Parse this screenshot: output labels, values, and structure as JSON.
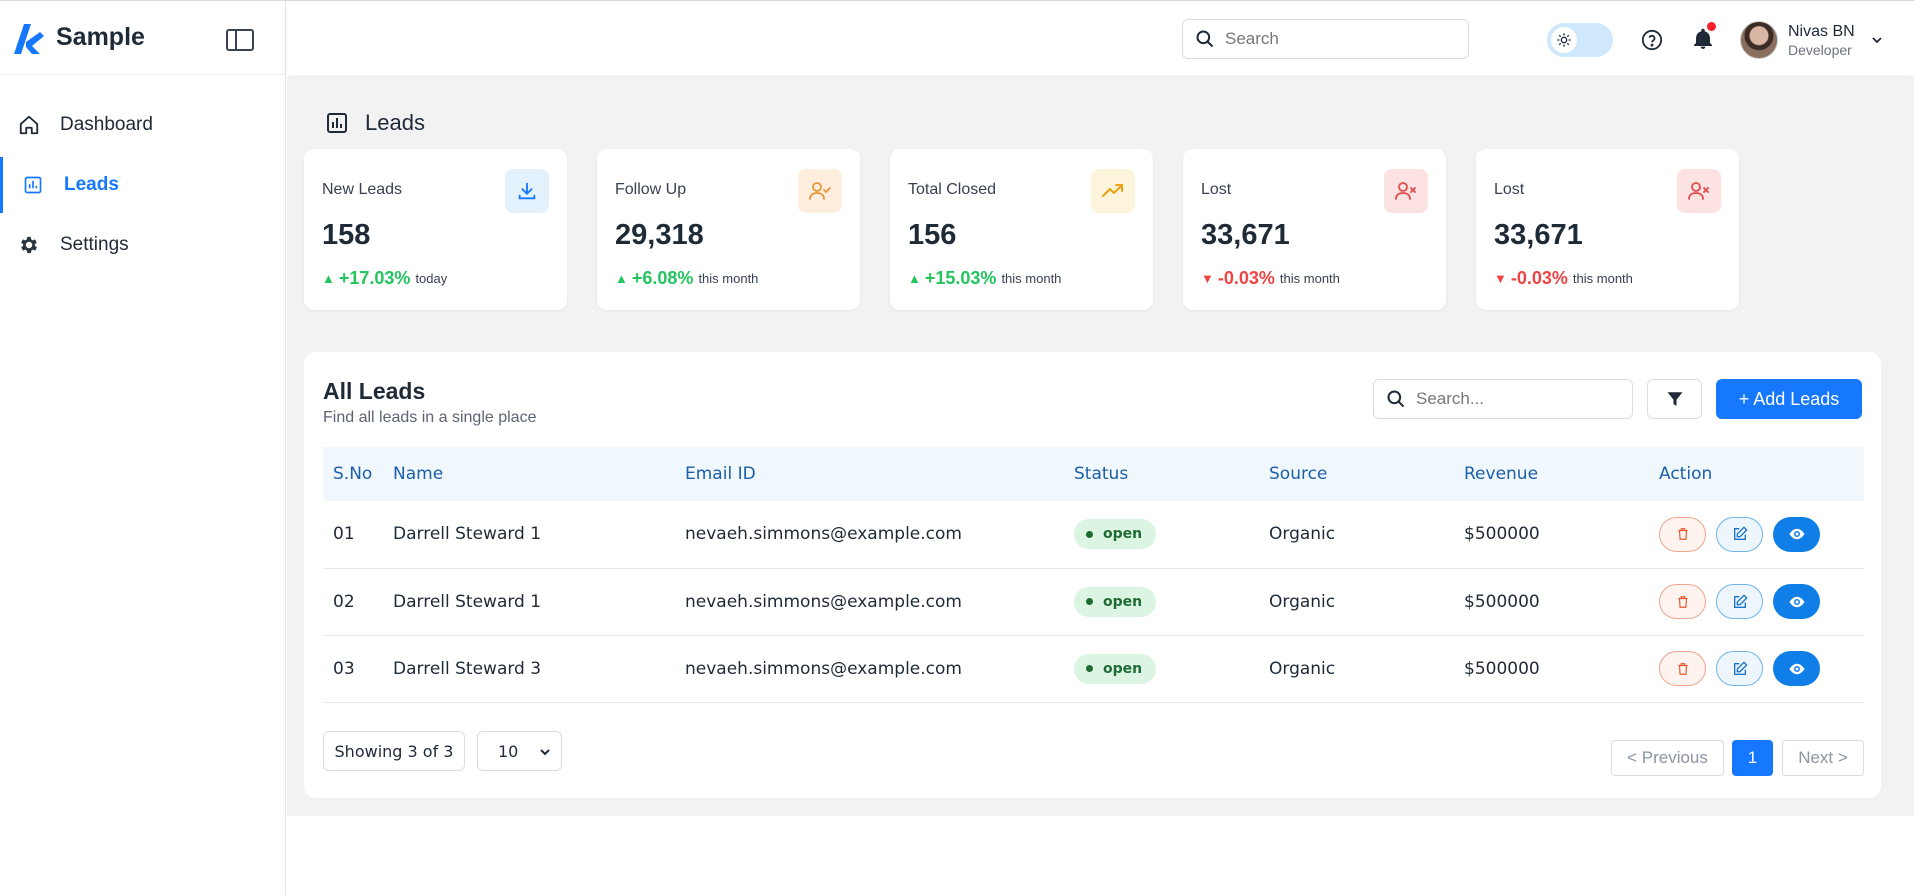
{
  "app": {
    "name": "Sample",
    "accent": "#1677ff"
  },
  "sidebar": {
    "items": [
      {
        "label": "Dashboard",
        "icon": "home-icon",
        "active": false
      },
      {
        "label": "Leads",
        "icon": "bar-chart-icon",
        "active": true
      },
      {
        "label": "Settings",
        "icon": "gear-icon",
        "active": false
      }
    ]
  },
  "topbar": {
    "search_placeholder": "Search",
    "user": {
      "name": "Nivas BN",
      "role": "Developer"
    }
  },
  "page": {
    "title": "Leads"
  },
  "stats": [
    {
      "label": "New Leads",
      "value": "158",
      "trend": "+17.03%",
      "direction": "up",
      "period": "today",
      "icon": "download-icon",
      "icon_bg": "#e3f1fd",
      "icon_color": "#1677ff"
    },
    {
      "label": "Follow Up",
      "value": "29,318",
      "trend": "+6.08%",
      "direction": "up",
      "period": "this month",
      "icon": "user-check-icon",
      "icon_bg": "#fdeedd",
      "icon_color": "#e8953b"
    },
    {
      "label": "Total Closed",
      "value": "156",
      "trend": "+15.03%",
      "direction": "up",
      "period": "this month",
      "icon": "trending-up-icon",
      "icon_bg": "#fdf4dc",
      "icon_color": "#e9a215"
    },
    {
      "label": "Lost",
      "value": "33,671",
      "trend": "-0.03%",
      "direction": "down",
      "period": "this month",
      "icon": "user-x-icon",
      "icon_bg": "#fde2e2",
      "icon_color": "#e24b4b"
    },
    {
      "label": "Lost",
      "value": "33,671",
      "trend": "-0.03%",
      "direction": "down",
      "period": "this month",
      "icon": "user-x-icon",
      "icon_bg": "#fde2e2",
      "icon_color": "#e24b4b"
    }
  ],
  "leads_panel": {
    "title": "All Leads",
    "subtitle": "Find all leads in a single place",
    "search_placeholder": "Search...",
    "add_label": "+ Add Leads",
    "columns": [
      "S.No",
      "Name",
      "Email ID",
      "Status",
      "Source",
      "Revenue",
      "Action"
    ],
    "rows": [
      {
        "sno": "01",
        "name": "Darrell Steward 1",
        "email": "nevaeh.simmons@example.com",
        "status": "open",
        "source": "Organic",
        "revenue": "$500000"
      },
      {
        "sno": "02",
        "name": "Darrell Steward 1",
        "email": "nevaeh.simmons@example.com",
        "status": "open",
        "source": "Organic",
        "revenue": "$500000"
      },
      {
        "sno": "03",
        "name": "Darrell Steward 3",
        "email": "nevaeh.simmons@example.com",
        "status": "open",
        "source": "Organic",
        "revenue": "$500000"
      }
    ],
    "footer": {
      "showing": "Showing 3 of 3",
      "page_size": "10",
      "prev_label": "< Previous",
      "current_page": "1",
      "next_label": "Next >"
    }
  }
}
